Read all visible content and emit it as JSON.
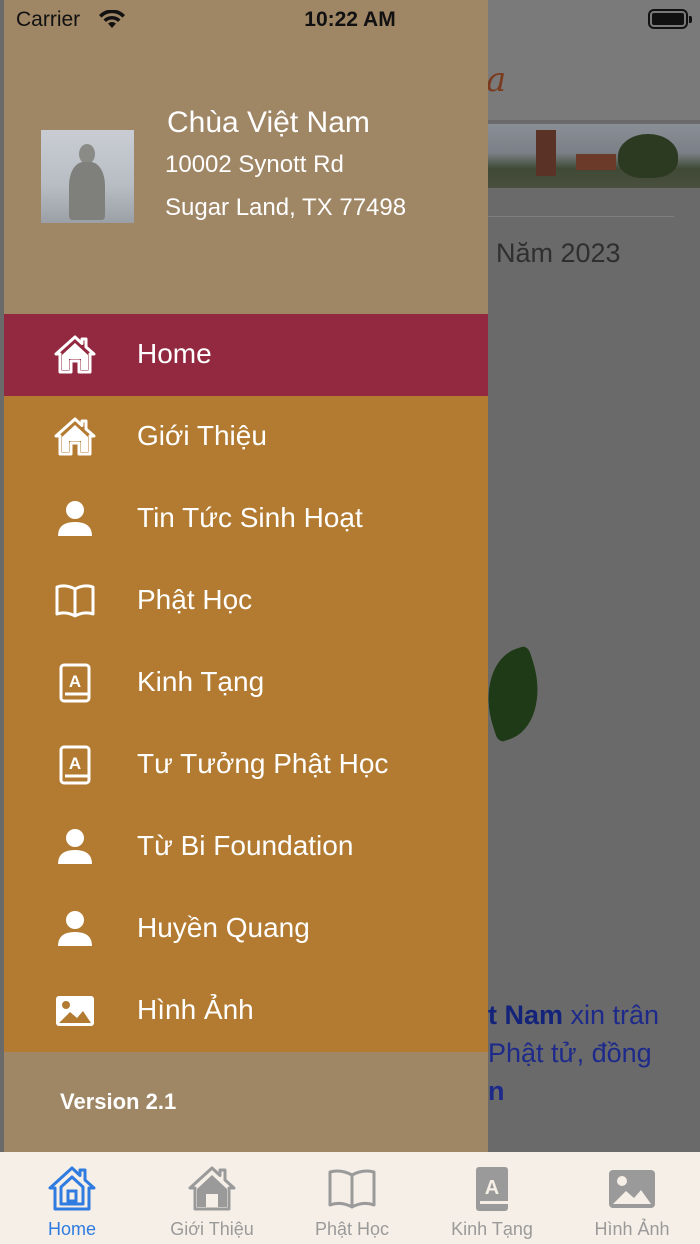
{
  "status_bar": {
    "carrier": "Carrier",
    "time": "10:22 AM"
  },
  "background_page": {
    "year_heading": "Năm 2023",
    "text_line1_bold": "t Nam",
    "text_line1": " xin trân",
    "text_line2": "Phật tử, đồng",
    "text_line3": "n"
  },
  "drawer": {
    "temple_name": "Chùa Việt Nam",
    "address_line1": "10002 Synott Rd",
    "address_line2": "Sugar Land, TX 77498",
    "version": "Version 2.1",
    "items": [
      {
        "label": "Home",
        "icon": "home-icon",
        "active": true
      },
      {
        "label": "Giới Thiệu",
        "icon": "home-icon",
        "active": false
      },
      {
        "label": "Tin Tức Sinh Hoạt",
        "icon": "person-icon",
        "active": false
      },
      {
        "label": "Phật Học",
        "icon": "book-icon",
        "active": false
      },
      {
        "label": "Kinh Tạng",
        "icon": "contact-book-icon",
        "active": false
      },
      {
        "label": "Tư Tưởng Phật Học",
        "icon": "contact-book-icon",
        "active": false
      },
      {
        "label": "Từ Bi Foundation",
        "icon": "person-icon",
        "active": false
      },
      {
        "label": "Huyền Quang",
        "icon": "person-icon",
        "active": false
      },
      {
        "label": "Hình Ảnh",
        "icon": "image-icon",
        "active": false
      }
    ]
  },
  "tab_bar": {
    "tabs": [
      {
        "label": "Home",
        "icon": "home-icon",
        "active": true
      },
      {
        "label": "Giới Thiệu",
        "icon": "home-icon",
        "active": false
      },
      {
        "label": "Phật Học",
        "icon": "book-icon",
        "active": false
      },
      {
        "label": "Kinh Tạng",
        "icon": "contact-book-icon",
        "active": false
      },
      {
        "label": "Hình Ảnh",
        "icon": "image-icon",
        "active": false
      }
    ]
  },
  "colors": {
    "drawer_header": "#9f8665",
    "menu_background": "#b27b31",
    "menu_active": "#922940",
    "tab_active": "#2f7be0",
    "tab_inactive": "#9a9a9a"
  }
}
